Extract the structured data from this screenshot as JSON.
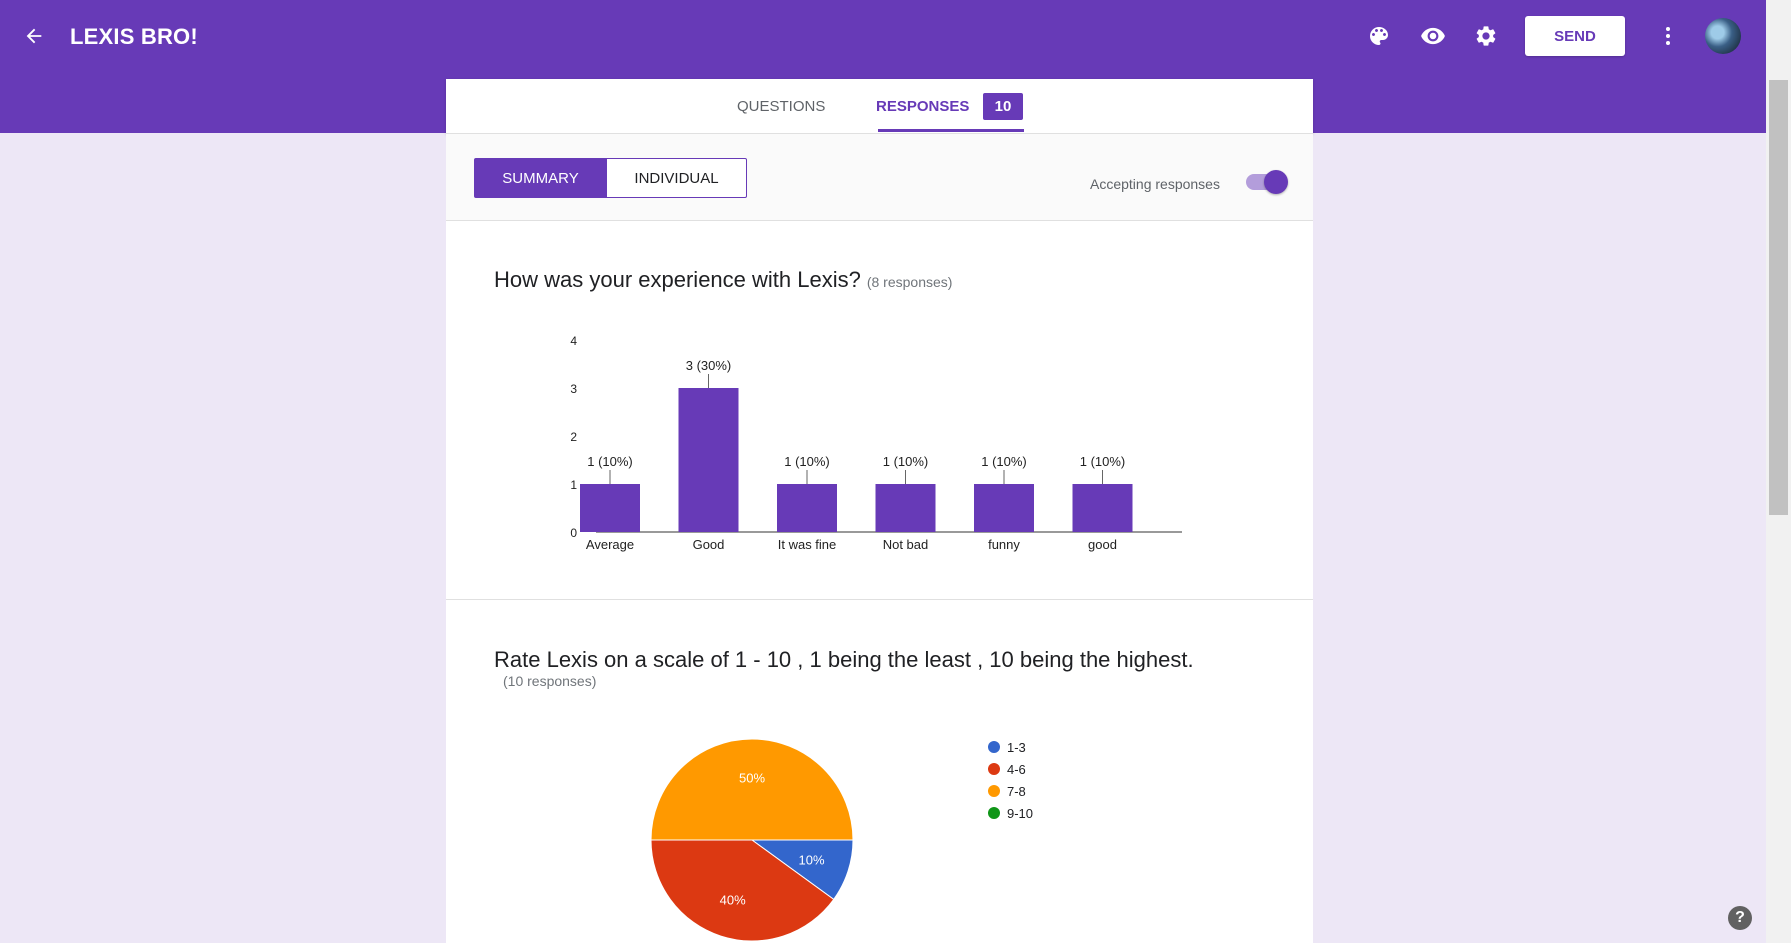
{
  "header": {
    "title": "LEXIS BRO!",
    "send_label": "SEND",
    "icons": [
      "back-arrow-icon",
      "palette-icon",
      "eye-icon",
      "gear-icon",
      "more-vert-icon"
    ],
    "bar_color": "#673ab7"
  },
  "tabs": {
    "questions": "QUESTIONS",
    "responses": "RESPONSES",
    "responses_count": "10"
  },
  "summary": {
    "summary_label": "SUMMARY",
    "individual_label": "INDIVIDUAL",
    "accepting_label": "Accepting responses",
    "accepting_on": true
  },
  "questions": [
    {
      "title": "How was your experience with Lexis?",
      "count_label": "(8 responses)"
    },
    {
      "title": "Rate Lexis on a scale of 1 - 10 , 1 being the least , 10 being the highest.",
      "count_label": "(10 responses)"
    }
  ],
  "chart_data": [
    {
      "type": "bar",
      "categories": [
        "Average",
        "Good",
        "It was fine",
        "Not bad",
        "funny",
        "good"
      ],
      "values": [
        1,
        3,
        1,
        1,
        1,
        1
      ],
      "data_labels": [
        "1 (10%)",
        "3 (30%)",
        "1 (10%)",
        "1 (10%)",
        "1 (10%)",
        "1 (10%)"
      ],
      "yticks": [
        "0",
        "1",
        "2",
        "3",
        "4"
      ],
      "ylim": [
        0,
        4
      ],
      "color": "#673ab7",
      "grid": false
    },
    {
      "type": "pie",
      "slices": [
        {
          "label": "1-3",
          "value": 10,
          "pct_label": "10%",
          "color": "#3366cc"
        },
        {
          "label": "4-6",
          "value": 40,
          "pct_label": "40%",
          "color": "#dc3912"
        },
        {
          "label": "7-8",
          "value": 50,
          "pct_label": "50%",
          "color": "#ff9900"
        },
        {
          "label": "9-10",
          "value": 0,
          "pct_label": "",
          "color": "#109618"
        }
      ],
      "legend_position": "right"
    }
  ],
  "help_label": "?"
}
